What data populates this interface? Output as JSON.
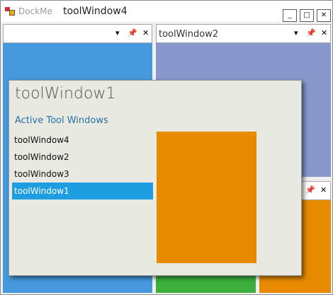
{
  "window": {
    "app_name": "DockMe",
    "active_title": "toolWindow4",
    "minimize_glyph": "🗕",
    "maximize_glyph": "🗖",
    "close_glyph": "✕"
  },
  "panes": {
    "left": {
      "title": "",
      "color": "#4599dc"
    },
    "right_top": {
      "title": "toolWindow2",
      "color": "#8898cc"
    },
    "bottom_middle": {
      "color": "#3daf3d"
    },
    "bottom_right": {
      "color": "#e88a00"
    }
  },
  "pane_buttons": {
    "dropdown": "▾",
    "pin": "📌",
    "close": "✕"
  },
  "switcher": {
    "title": "toolWindow1",
    "subtitle": "Active Tool Windows",
    "items": [
      {
        "label": "toolWindow4",
        "selected": false
      },
      {
        "label": "toolWindow2",
        "selected": false
      },
      {
        "label": "toolWindow3",
        "selected": false
      },
      {
        "label": "toolWindow1",
        "selected": true
      }
    ],
    "preview_color": "#e88a00",
    "selection_color": "#1e9ee0"
  }
}
